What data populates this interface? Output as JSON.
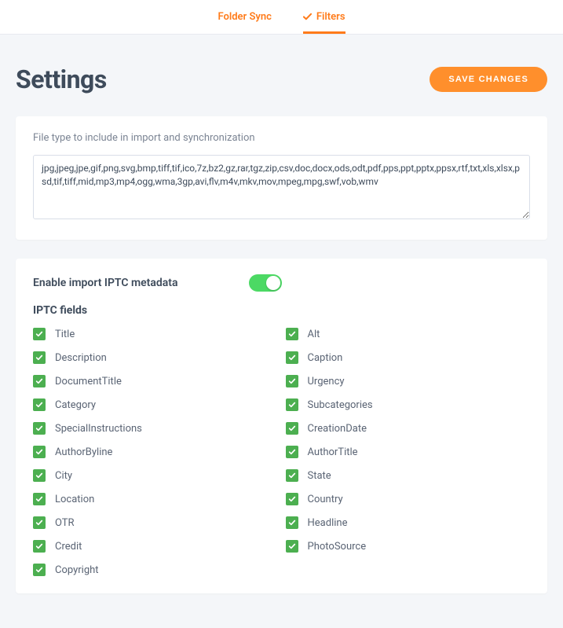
{
  "tabs": {
    "folder_sync": "Folder Sync",
    "filters": "Filters"
  },
  "header": {
    "title": "Settings",
    "save_label": "SAVE CHANGES"
  },
  "filetypes": {
    "label": "File type to include in import and synchronization",
    "value": "jpg,jpeg,jpe,gif,png,svg,bmp,tiff,tif,ico,7z,bz2,gz,rar,tgz,zip,csv,doc,docx,ods,odt,pdf,pps,ppt,pptx,ppsx,rtf,txt,xls,xlsx,psd,tif,tiff,mid,mp3,mp4,ogg,wma,3gp,avi,flv,m4v,mkv,mov,mpeg,mpg,swf,vob,wmv"
  },
  "iptc": {
    "toggle_label": "Enable import IPTC metadata",
    "fields_heading": "IPTC fields",
    "left": [
      "Title",
      "Description",
      "DocumentTitle",
      "Category",
      "SpecialInstructions",
      "AuthorByline",
      "City",
      "Location",
      "OTR",
      "Credit",
      "Copyright"
    ],
    "right": [
      "Alt",
      "Caption",
      "Urgency",
      "Subcategories",
      "CreationDate",
      "AuthorTitle",
      "State",
      "Country",
      "Headline",
      "PhotoSource"
    ]
  }
}
